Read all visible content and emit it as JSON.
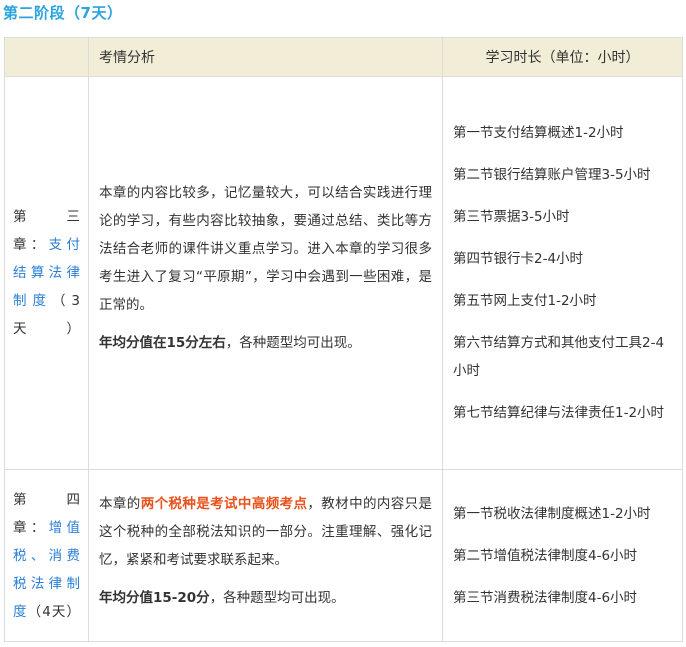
{
  "stage_title": "第二阶段（7天）",
  "header": {
    "col1": "",
    "col2": "考情分析",
    "col3": "学习时长（单位：小时）"
  },
  "rows": [
    {
      "chapter_prefix": "第　三　章：",
      "chapter_link": "支付结算法律制度",
      "chapter_suffix": "（3天）",
      "analysis_text": "本章的内容比较多，记忆量较大，可以结合实践进行理论的学习，有些内容比较抽象，要通过总结、类比等方法结合老师的课件讲义重点学习。进入本章的学习很多考生进入了复习“平原期”，学习中会遇到一些困难，是正常的。",
      "score_bold": "年均分值在15分左右",
      "score_rest": "，各种题型均可出现。",
      "items": [
        "第一节支付结算概述1-2小时",
        "第二节银行结算账户管理3-5小时",
        "第三节票据3-5小时",
        "第四节银行卡2-4小时",
        "第五节网上支付1-2小时",
        "第六节结算方式和其他支付工具2-4小时",
        "第七节结算纪律与法律责任1-2小时"
      ]
    },
    {
      "chapter_prefix": "第　四　章：",
      "chapter_link": "增值税、消费税法律制度",
      "chapter_suffix": "（4天）",
      "analysis_pre": "本章的",
      "analysis_highlight": "两个税种是考试中高频考点",
      "analysis_post": "，教材中的内容只是这个税种的全部税法知识的一部分。注重理解、强化记忆，紧紧和考试要求联系起来。",
      "score_bold": "年均分值15-20分",
      "score_rest": "，各种题型均可出现。",
      "items": [
        "第一节税收法律制度概述1-2小时",
        "第二节增值税法律制度4-6小时",
        "第三节消费税法律制度4-6小时"
      ]
    }
  ]
}
